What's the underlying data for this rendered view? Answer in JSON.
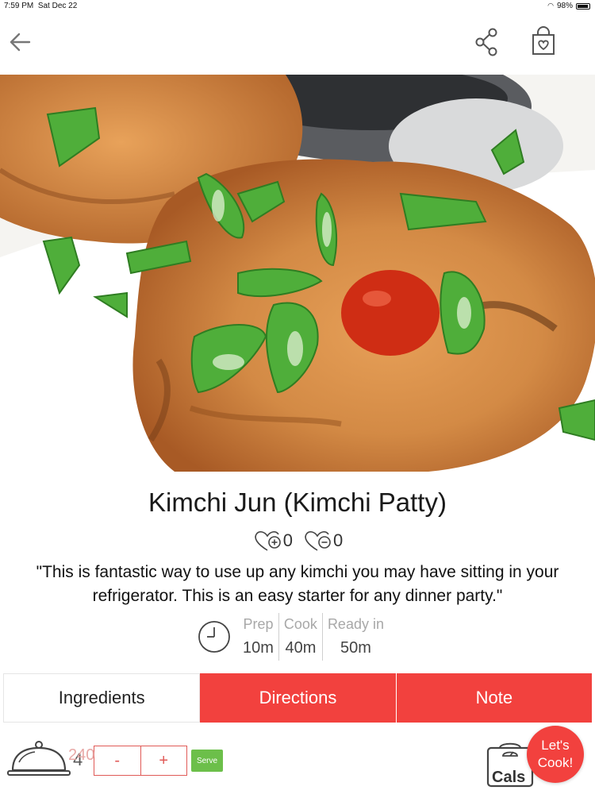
{
  "status": {
    "time": "7:59 PM",
    "date": "Sat Dec 22",
    "battery": "98%"
  },
  "recipe": {
    "title": "Kimchi Jun (Kimchi Patty)",
    "likes": "0",
    "dislikes": "0",
    "description": "\"This is fantastic way to use up any kimchi you may have sitting in your refrigerator. This is an easy starter for any dinner party.\"",
    "times": [
      {
        "label": "Prep",
        "value": "10m"
      },
      {
        "label": "Cook",
        "value": "40m"
      },
      {
        "label": "Ready in",
        "value": "50m"
      }
    ]
  },
  "tabs": [
    {
      "label": "Ingredients"
    },
    {
      "label": "Directions"
    },
    {
      "label": "Note"
    }
  ],
  "servings": {
    "count": "4",
    "minus": "-",
    "plus": "+",
    "serve": "Serve"
  },
  "nutrition": {
    "label": "Cals",
    "value": "240"
  },
  "cook_button": {
    "line1": "Let's",
    "line2": "Cook!"
  },
  "colors": {
    "accent": "#f2413e",
    "serve_green": "#6cbf4a"
  },
  "icons": [
    "back-arrow-icon",
    "share-icon",
    "shopping-bag-heart-icon",
    "clock-icon",
    "cloche-icon",
    "scale-icon"
  ]
}
